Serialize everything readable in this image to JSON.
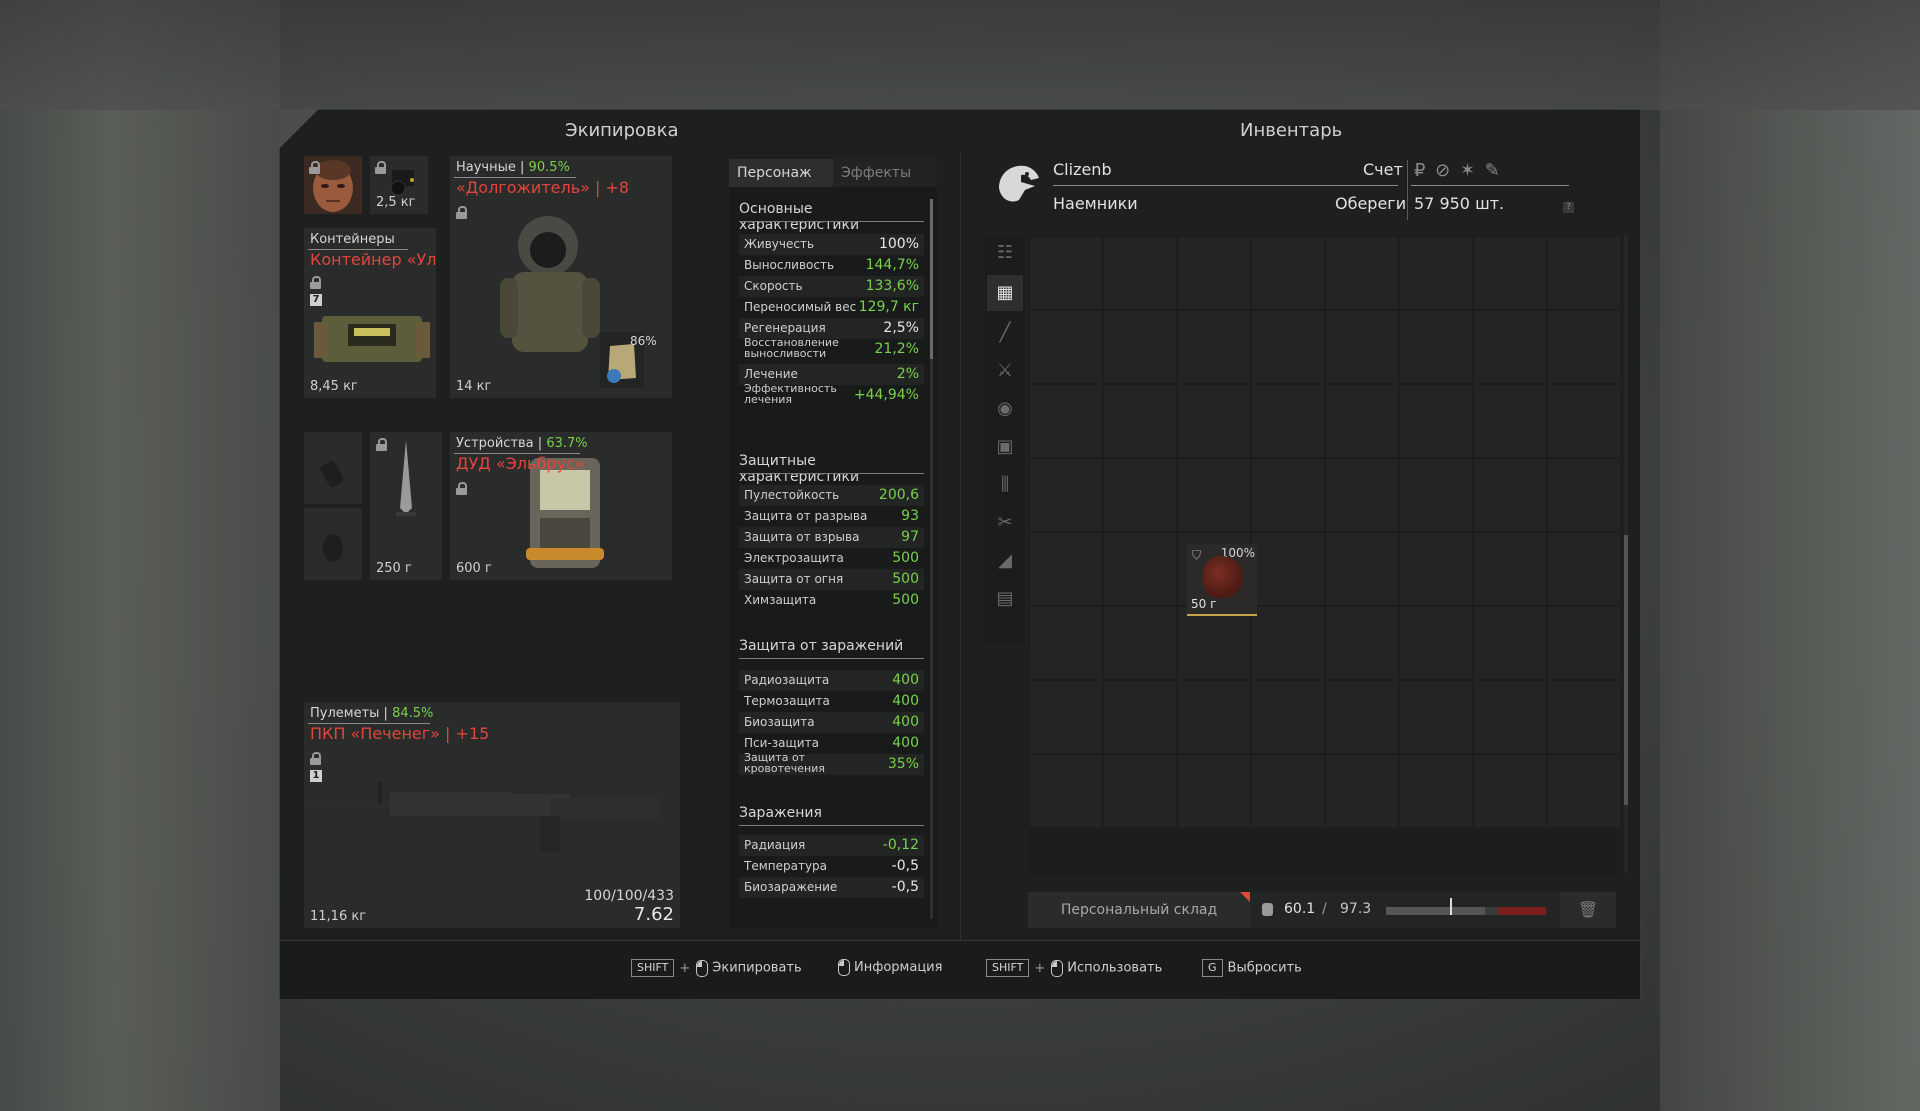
{
  "equipment": {
    "title": "Экипировка",
    "face_weight": "2,5 кг",
    "container": {
      "category": "Контейнеры",
      "name": "Контейнер «Улей»",
      "badge": "7",
      "weight": "8,45 кг"
    },
    "armor": {
      "category": "Научные",
      "pct": "90.5%",
      "name": "«Долгожитель» | +8",
      "weight": "14 кг",
      "insert_pct": "86%"
    },
    "knife_weight": "250 г",
    "device": {
      "category": "Устройства",
      "pct": "63.7%",
      "name": "ДУД «Эльбрус»",
      "weight": "600 г"
    },
    "weapon": {
      "category": "Пулеметы",
      "pct": "84.5%",
      "name": "ПКП «Печенег» | +15",
      "badge": "1",
      "ammo": "100/100/433",
      "caliber": "7.62",
      "weight": "11,16 кг"
    }
  },
  "stats": {
    "tab_character": "Персонаж",
    "tab_effects": "Эффекты",
    "sec_basic": "Основные характеристики",
    "basic": [
      {
        "label": "Живучесть",
        "value": "100%"
      },
      {
        "label": "Выносливость",
        "value": "144,7%"
      },
      {
        "label": "Скорость",
        "value": "133,6%"
      },
      {
        "label": "Переносимый вес",
        "value": "129,7 кг"
      },
      {
        "label": "Регенерация",
        "value": "2,5%"
      },
      {
        "label": "Восстановление выносливости",
        "value": "21,2%"
      },
      {
        "label": "Лечение",
        "value": "2%"
      },
      {
        "label": "Эффективность лечения",
        "value": "+44,94%"
      }
    ],
    "sec_protect": "Защитные характеристики",
    "protect": [
      {
        "label": "Пулестойкость",
        "value": "200,6"
      },
      {
        "label": "Защита от разрыва",
        "value": "93"
      },
      {
        "label": "Защита от взрыва",
        "value": "97"
      },
      {
        "label": "Электрозащита",
        "value": "500"
      },
      {
        "label": "Защита от огня",
        "value": "500"
      },
      {
        "label": "Химзащита",
        "value": "500"
      }
    ],
    "sec_contam": "Защита от заражений",
    "contam": [
      {
        "label": "Радиозащита",
        "value": "400"
      },
      {
        "label": "Термозащита",
        "value": "400"
      },
      {
        "label": "Биозащита",
        "value": "400"
      },
      {
        "label": "Пси-защита",
        "value": "400"
      },
      {
        "label": "Защита от кровотечения",
        "value": "35%"
      }
    ],
    "sec_infect": "Заражения",
    "infect": [
      {
        "label": "Радиация",
        "value": "-0,12"
      },
      {
        "label": "Температура",
        "value": "-0,5"
      },
      {
        "label": "Биозаражение",
        "value": "-0,5"
      }
    ]
  },
  "inventory": {
    "title": "Инвентарь",
    "player_name": "Clizenb",
    "faction": "Наемники",
    "account_label": "Счет",
    "amulets_label": "Обереги",
    "amount": "57 950 шт.",
    "currency_icons": "₽ ⊘ ✶ ✎",
    "help": "?",
    "item": {
      "pct": "100%",
      "weight": "50 г"
    },
    "storage_label": "Персональный склад",
    "weight_current": "60.1",
    "weight_sep": "/",
    "weight_max": "97.3",
    "weight_fill": 0.618
  },
  "footer": {
    "key_shift": "SHIFT",
    "equip": "Экипировать",
    "info": "Информация",
    "use": "Использовать",
    "key_g": "G",
    "drop": "Выбросить"
  }
}
